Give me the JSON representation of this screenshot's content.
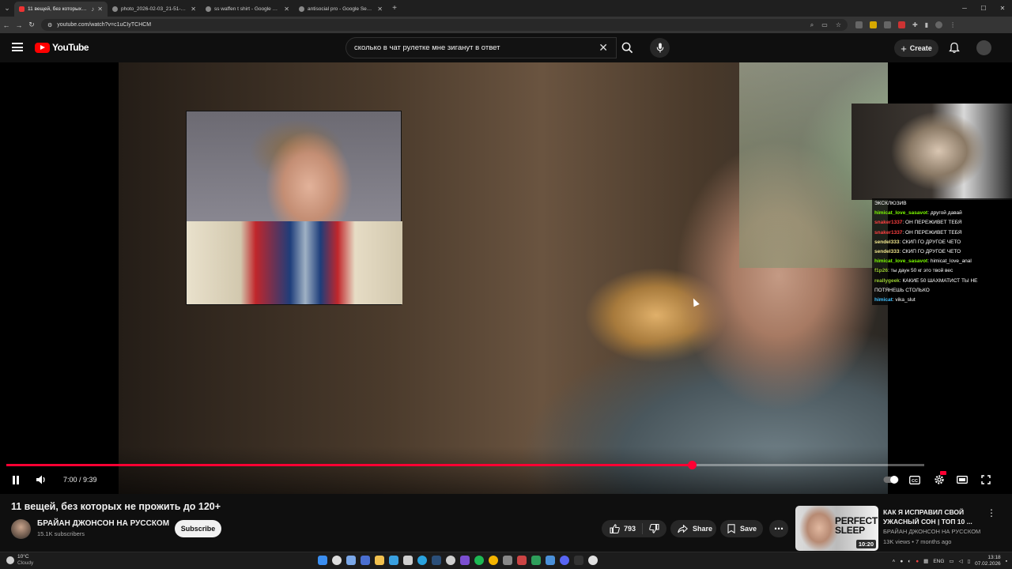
{
  "browser": {
    "tabs": [
      {
        "title": "11 вещей, без которых не",
        "active": true,
        "icon": "youtube-favicon"
      },
      {
        "title": "photo_2026-02-03_21-51-50.jp",
        "active": false,
        "icon": "globe-favicon"
      },
      {
        "title": "ss waffen t shirt - Google Search",
        "active": false,
        "icon": "google-favicon"
      },
      {
        "title": "antisocial pro - Google Search",
        "active": false,
        "icon": "google-favicon"
      }
    ],
    "url": "youtube.com/watch?v=c1uCIyTCHCM"
  },
  "youtube": {
    "logo_text": "YouTube",
    "search_query": "сколько в чат рулетке мне зиганут в ответ",
    "create_label": "Create"
  },
  "player": {
    "progress_fraction": 0.7469,
    "time_current": "7:00",
    "time_separator": " / ",
    "time_total": "9:39",
    "accent_color": "#ff0033"
  },
  "stream_chat": {
    "header": "ЭКСКЛЮЗИВ",
    "messages": [
      {
        "user": "himicat_love_sasavot",
        "color": "#7cfc00",
        "text": "другой давай"
      },
      {
        "user": "snaker1337",
        "color": "#ff4040",
        "text": "ОН ПЕРЕЖИВЕТ ТЕБЯ"
      },
      {
        "user": "snaker1337",
        "color": "#ff4040",
        "text": "ОН ПЕРЕЖИВЕТ ТЕБЯ"
      },
      {
        "user": "sendel333",
        "color": "#f0e68c",
        "text": "СКИП ГО ДРУГОЕ ЧЕТО"
      },
      {
        "user": "sendel333",
        "color": "#f0e68c",
        "text": "СКИП ГО ДРУГОЕ ЧЕТО"
      },
      {
        "user": "himicat_love_sasavot",
        "color": "#7cfc00",
        "text": "himicat_love_anal"
      },
      {
        "user": "f1p26",
        "color": "#9acd32",
        "text": "ты даун 50 кг это твой вес"
      },
      {
        "user": "reallygeek",
        "color": "#9acd32",
        "text": "КАКИЕ 50 ШАХМАТИСТ ТЫ НЕ"
      },
      {
        "user": "",
        "color": "#ffffff",
        "text": "ПОТЯНЕШЬ СТОЛЬКО"
      },
      {
        "user": "himicat",
        "color": "#40c0ff",
        "text": "vika_slut"
      }
    ]
  },
  "video": {
    "title": "11 вещей, без которых не прожить до 120+",
    "channel_name": "БРАЙАН ДЖОНСОН НА РУССКОМ",
    "subscribers": "15.1K subscribers",
    "subscribe_label": "Subscribe",
    "likes": "793",
    "share_label": "Share",
    "save_label": "Save"
  },
  "recommendation": {
    "thumb_text_1": "PERFECT",
    "thumb_text_2": "SLEEP",
    "duration": "10:20",
    "title": "КАК Я ИСПРАВИЛ СВОЙ УЖАСНЫЙ СОН | ТОП 10 ...",
    "channel": "БРАЙАН ДЖОНСОН НА РУССКОМ",
    "meta": "13K views • 7 months ago"
  },
  "taskbar": {
    "temperature": "10°C",
    "weather": "Cloudy",
    "language": "ENG",
    "time": "13:18",
    "date": "07.02.2026"
  }
}
